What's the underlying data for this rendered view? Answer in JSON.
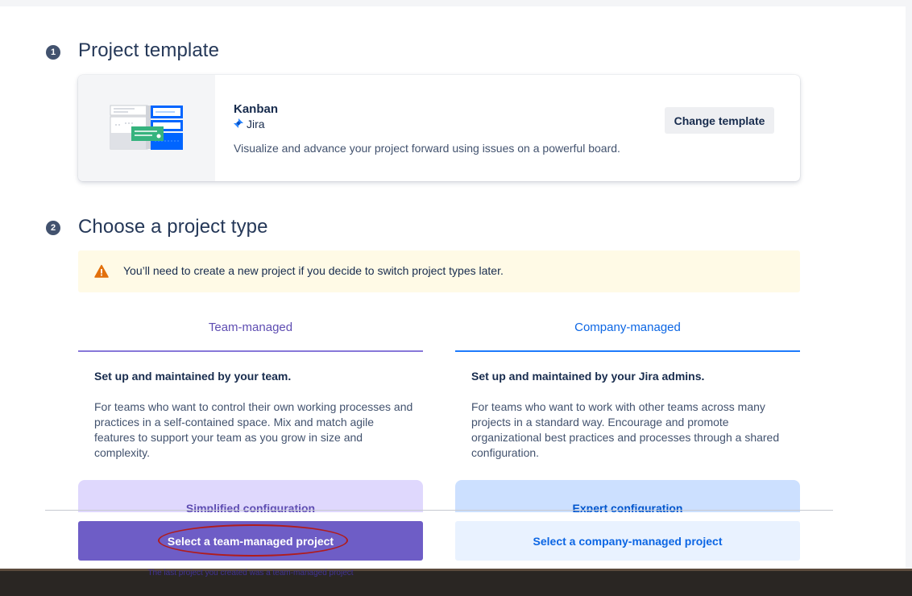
{
  "step1": {
    "number": "1",
    "title": "Project template"
  },
  "template": {
    "name": "Kanban",
    "product": "Jira",
    "description": "Visualize and advance your project forward using issues on a powerful board.",
    "change_button": "Change template"
  },
  "step2": {
    "number": "2",
    "title": "Choose a project type"
  },
  "warning": {
    "text": "You’ll need to create a new project if you decide to switch project types later."
  },
  "team_managed": {
    "tab": "Team-managed",
    "subhead": "Set up and maintained by your team.",
    "description": "For teams who want to control their own working processes and practices in a self-contained space. Mix and match agile features to support your team as you grow in size and complexity.",
    "config_label": "Simplified configuration",
    "select_button": "Select a team-managed project",
    "last_note": "The last project you created was a team-managed project"
  },
  "company_managed": {
    "tab": "Company-managed",
    "subhead": "Set up and maintained by your Jira admins.",
    "description": "For teams who want to work with other teams across many projects in a standard way. Encourage and promote organizational best practices and processes through a shared configuration.",
    "config_label": "Expert configuration",
    "select_button": "Select a company-managed project"
  },
  "colors": {
    "team_accent": "#6554c0",
    "team_button": "#6e5dc6",
    "team_config_bg": "#dfd8fd",
    "company_accent": "#0c66e4",
    "company_button_bg": "#e9f2ff",
    "company_config_bg": "#cce0ff",
    "warning_bg": "#fffae6",
    "warning_icon": "#e2700c"
  },
  "icons": {
    "jira_logo": "jira-logo-icon",
    "warning": "warning-icon",
    "kanban_illustration": "kanban-illustration"
  }
}
